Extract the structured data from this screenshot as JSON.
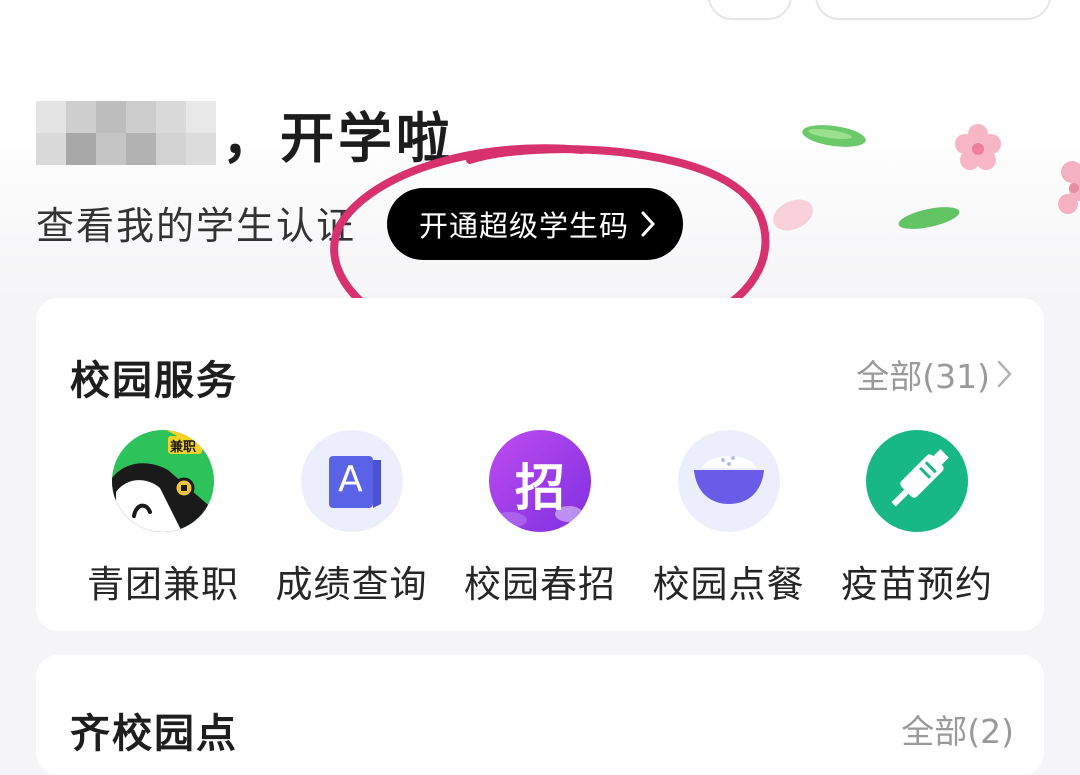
{
  "greeting": {
    "suffix": "，开学啦",
    "subtitle": "查看我的学生认证",
    "vip_button_label": "开通超级学生码"
  },
  "campus_services": {
    "title": "校园服务",
    "more_label": "全部(31)",
    "items": [
      {
        "label": "青团兼职",
        "icon": "part-time-job-icon",
        "badge": "兼职",
        "color": "#2ec25a"
      },
      {
        "label": "成绩查询",
        "icon": "grade-query-icon",
        "glyph": "A",
        "color": "#5a63e6"
      },
      {
        "label": "校园春招",
        "icon": "spring-recruitment-icon",
        "glyph": "招",
        "color": "#9a39e8"
      },
      {
        "label": "校园点餐",
        "icon": "food-order-icon",
        "color": "#6a5ce8"
      },
      {
        "label": "疫苗预约",
        "icon": "vaccine-icon",
        "color": "#18b886"
      }
    ]
  },
  "second_card": {
    "title": "齐校园点",
    "more_label": "全部(2)"
  },
  "colors": {
    "background": "#f5f5f7",
    "annotation": "#d8326e",
    "vip_button_bg": "#000000"
  }
}
